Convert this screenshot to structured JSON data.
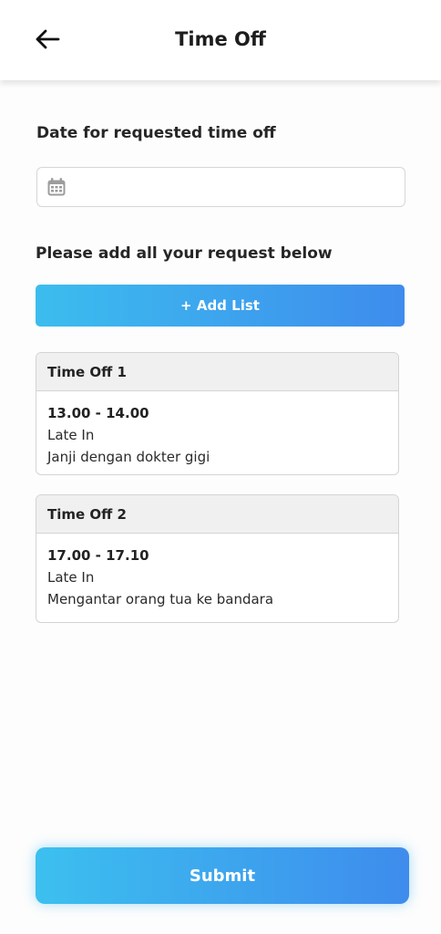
{
  "header": {
    "title": "Time Off",
    "back_icon": "arrow-left-icon"
  },
  "date_section": {
    "label": "Date for requested time off",
    "value": "",
    "placeholder": "",
    "icon": "calendar-icon"
  },
  "request_section": {
    "label": "Please add all your request below",
    "add_button_label": "+ Add List"
  },
  "requests": [
    {
      "title": "Time Off 1",
      "time": "13.00 - 14.00",
      "type": "Late In",
      "note": "Janji dengan dokter gigi"
    },
    {
      "title": "Time Off 2",
      "time": "17.00 - 17.10",
      "type": "Late In",
      "note": "Mengantar orang tua ke bandara"
    }
  ],
  "submit_label": "Submit",
  "colors": {
    "accent_start": "#3cbdee",
    "accent_end": "#3e8ced"
  }
}
